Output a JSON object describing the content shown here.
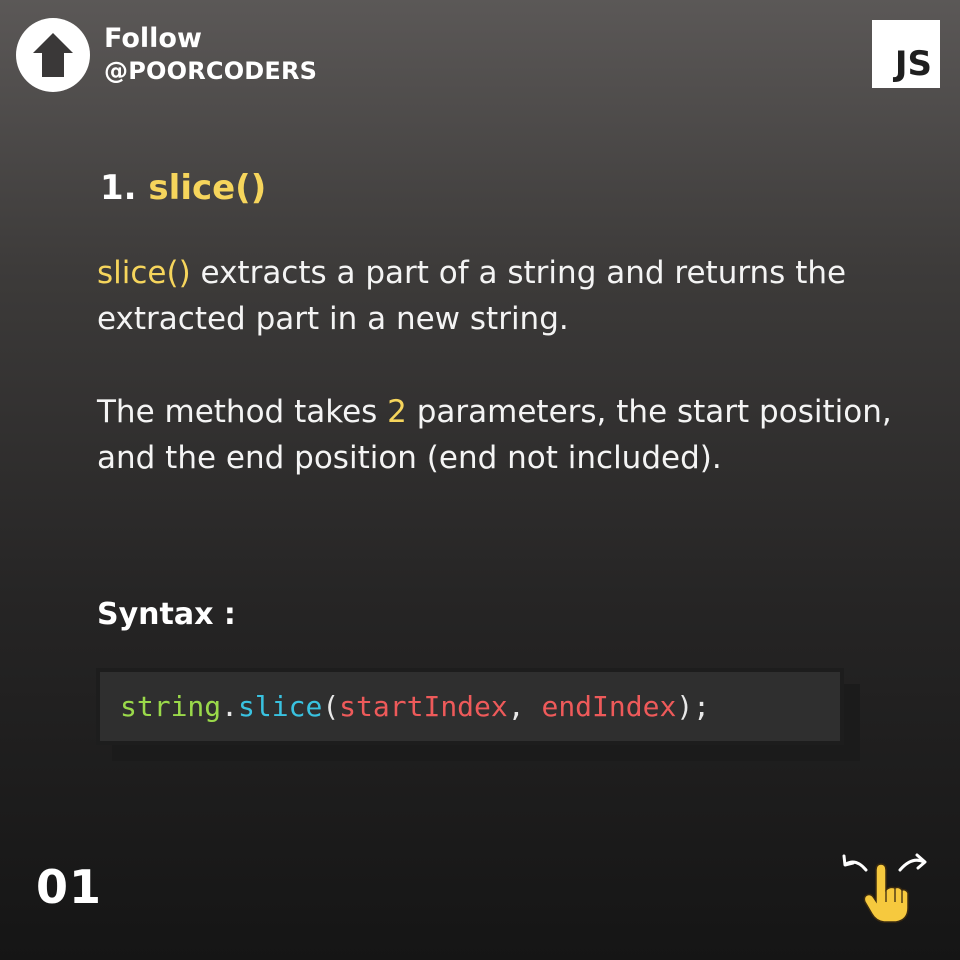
{
  "header": {
    "follow_label": "Follow",
    "handle": "@POORCODERS",
    "logo_text": "JS",
    "follow_icon": "arrow-up-icon"
  },
  "title": {
    "number": "1.",
    "method": "slice()"
  },
  "description": {
    "para1_highlight": "slice()",
    "para1_rest": " extracts a part of a string and returns the extracted part in a new string.",
    "para2_before": "The method takes ",
    "para2_highlight": "2",
    "para2_after": " parameters, the start position, and the end position (end not included)."
  },
  "syntax": {
    "label": "Syntax :",
    "code": {
      "object": "string",
      "dot": ".",
      "method": "slice",
      "open_paren": "(",
      "param1": "startIndex",
      "comma": ", ",
      "param2": "endIndex",
      "close": ");"
    }
  },
  "footer": {
    "page_number": "01",
    "swipe_icon": "swipe-hand-icon"
  },
  "colors": {
    "highlight": "#f6d55c",
    "code_object": "#9ad94a",
    "code_method": "#39c2e0",
    "code_params": "#ee5a5a"
  }
}
